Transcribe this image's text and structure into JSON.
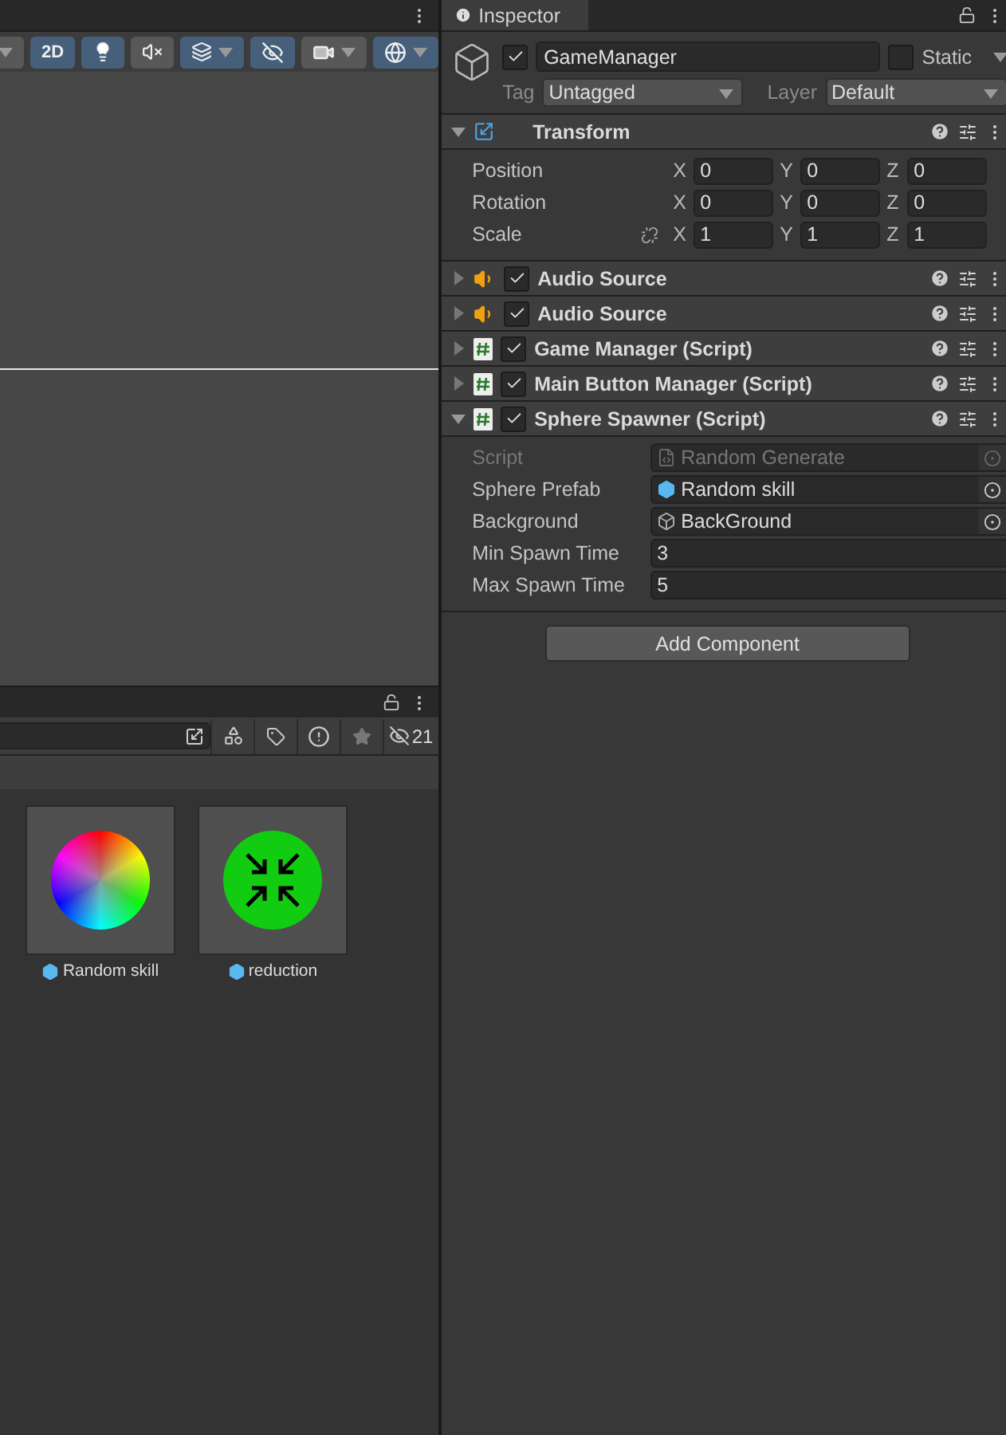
{
  "scene_toolbar": {
    "buttons": [
      {
        "kind": "menu",
        "selected": false
      },
      {
        "kind": "text",
        "label": "2D",
        "selected": true
      },
      {
        "kind": "light",
        "selected": true
      },
      {
        "kind": "audio",
        "selected": false
      },
      {
        "kind": "effects",
        "selected": true
      },
      {
        "kind": "visibility",
        "selected": true
      },
      {
        "kind": "camera",
        "selected": false
      },
      {
        "kind": "gizmos",
        "selected": true
      }
    ]
  },
  "inspector": {
    "tab": "Inspector",
    "object": {
      "name": "GameManager",
      "active": true,
      "static_label": "Static",
      "static": false,
      "tag_label": "Tag",
      "tag": "Untagged",
      "layer_label": "Layer",
      "layer": "Default"
    },
    "components": [
      {
        "title": "Transform",
        "kind": "transform",
        "expanded": true,
        "properties": [
          {
            "kind": "vector",
            "label": "Position",
            "values": [
              {
                "axis": "X",
                "value": "0"
              },
              {
                "axis": "Y",
                "value": "0"
              },
              {
                "axis": "Z",
                "value": "0"
              }
            ]
          },
          {
            "kind": "vector",
            "label": "Rotation",
            "values": [
              {
                "axis": "X",
                "value": "0"
              },
              {
                "axis": "Y",
                "value": "0"
              },
              {
                "axis": "Z",
                "value": "0"
              }
            ]
          },
          {
            "kind": "vector",
            "label": "Scale",
            "constrained": false,
            "values": [
              {
                "axis": "X",
                "value": "1"
              },
              {
                "axis": "Y",
                "value": "1"
              },
              {
                "axis": "Z",
                "value": "1"
              }
            ]
          }
        ]
      },
      {
        "title": "Audio Source",
        "kind": "audio",
        "enabled": true,
        "expanded": false
      },
      {
        "title": "Audio Source",
        "kind": "audio",
        "enabled": true,
        "expanded": false
      },
      {
        "title": "Game Manager (Script)",
        "kind": "script",
        "enabled": true,
        "expanded": false
      },
      {
        "title": "Main Button Manager (Script)",
        "kind": "script",
        "enabled": true,
        "expanded": false
      },
      {
        "title": "Sphere Spawner (Script)",
        "kind": "script",
        "enabled": true,
        "expanded": true,
        "properties": [
          {
            "kind": "script",
            "label": "Script",
            "value": "Random Generate",
            "disabled": true
          },
          {
            "kind": "prefab",
            "label": "Sphere Prefab",
            "value": "Random skill",
            "disabled": false
          },
          {
            "kind": "gameobject",
            "label": "Background",
            "value": "BackGround",
            "disabled": false
          },
          {
            "kind": "number",
            "label": "Min Spawn Time",
            "value": "3"
          },
          {
            "kind": "number",
            "label": "Max Spawn Time",
            "value": "5"
          }
        ]
      }
    ],
    "add_button": "Add Component"
  },
  "project": {
    "hidden_count": "21",
    "assets": [
      {
        "name": "Random skill",
        "kind": "color-sphere"
      },
      {
        "name": "reduction",
        "kind": "shrink"
      }
    ]
  }
}
